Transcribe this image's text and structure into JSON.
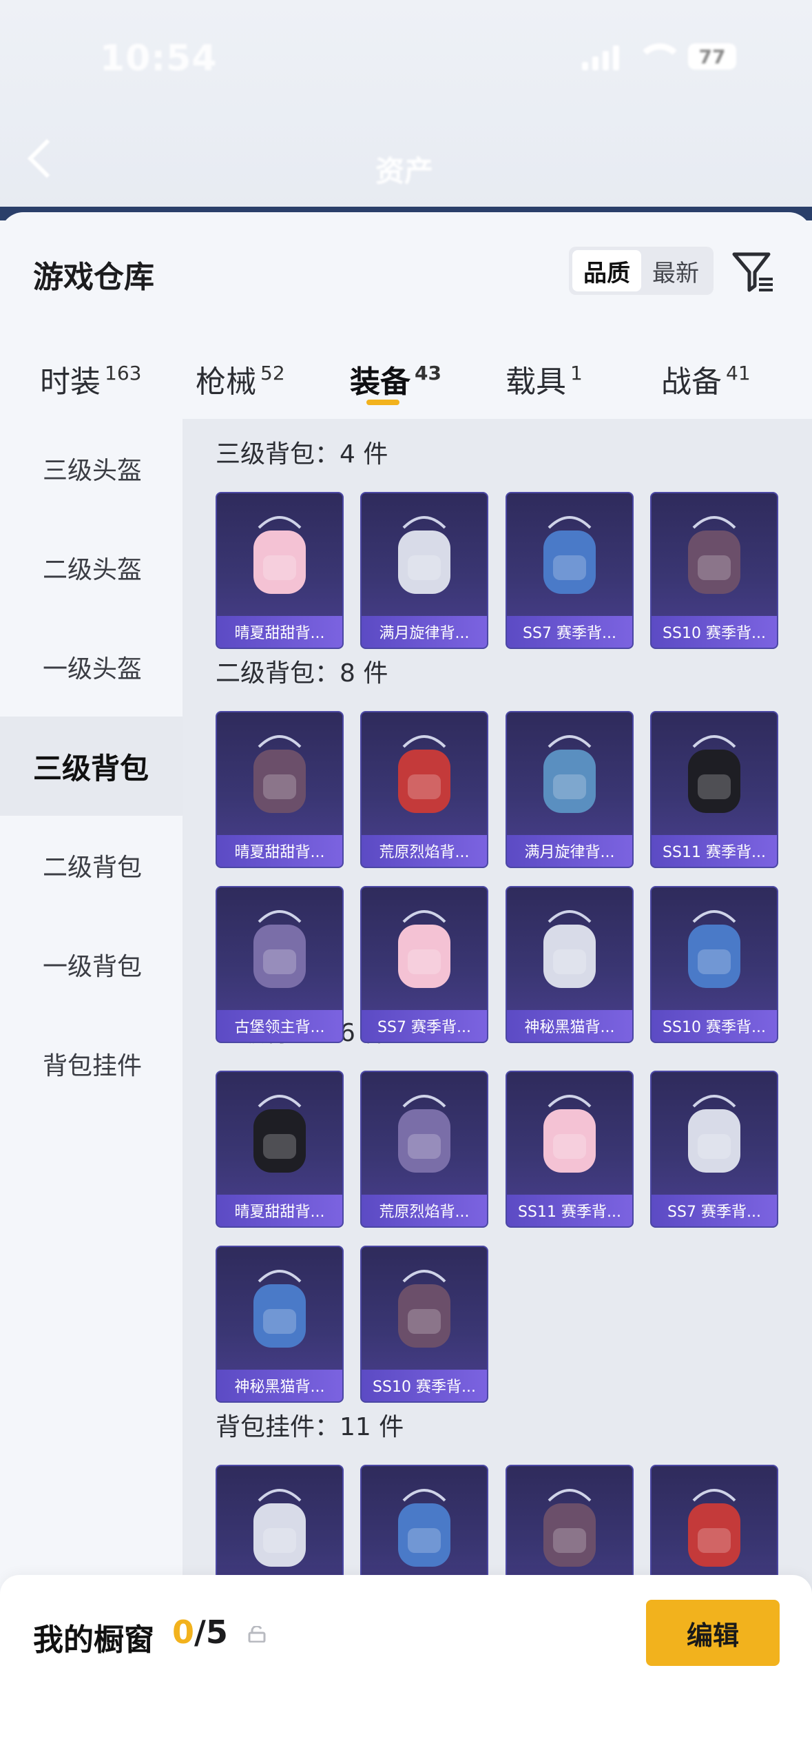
{
  "status_bar": {
    "time": "10:54",
    "battery": "77"
  },
  "header": {
    "active_tab": "资产"
  },
  "warehouse": {
    "title": "游戏仓库",
    "sort": {
      "options": [
        "品质",
        "最新"
      ],
      "selected": "品质"
    }
  },
  "tabs": [
    {
      "label": "时装",
      "count": "163"
    },
    {
      "label": "枪械",
      "count": "52"
    },
    {
      "label": "装备",
      "count": "43",
      "active": true
    },
    {
      "label": "载具",
      "count": "1"
    },
    {
      "label": "战备",
      "count": "41"
    }
  ],
  "sidebar": [
    {
      "label": "三级头盔"
    },
    {
      "label": "二级头盔"
    },
    {
      "label": "一级头盔"
    },
    {
      "label": "三级背包",
      "active": true
    },
    {
      "label": "二级背包"
    },
    {
      "label": "一级背包"
    },
    {
      "label": "背包挂件"
    }
  ],
  "sections": [
    {
      "title": "三级背包：4 件",
      "items": [
        "晴夏甜甜背...",
        "满月旋律背...",
        "SS7 赛季背...",
        "SS10 赛季背..."
      ]
    },
    {
      "title": "二级背包：8 件",
      "items": [
        "晴夏甜甜背...",
        "荒原烈焰背...",
        "满月旋律背...",
        "SS11 赛季背...",
        "古堡领主背...",
        "SS7 赛季背...",
        "神秘黑猫背...",
        "SS10 赛季背..."
      ]
    },
    {
      "title": "一级背包：6 件",
      "items": [
        "晴夏甜甜背...",
        "荒原烈焰背...",
        "SS11 赛季背...",
        "SS7 赛季背...",
        "神秘黑猫背...",
        "SS10 赛季背..."
      ]
    },
    {
      "title": "背包挂件：11 件",
      "items": [
        "",
        "",
        "",
        ""
      ]
    }
  ],
  "showcase": {
    "title": "我的橱窗",
    "current": "0",
    "total": "/5"
  },
  "edit_label": "编辑",
  "colors": {
    "accent": "#f2b21d",
    "card_bg": "#3a3673",
    "caption": "#6a55d4"
  }
}
